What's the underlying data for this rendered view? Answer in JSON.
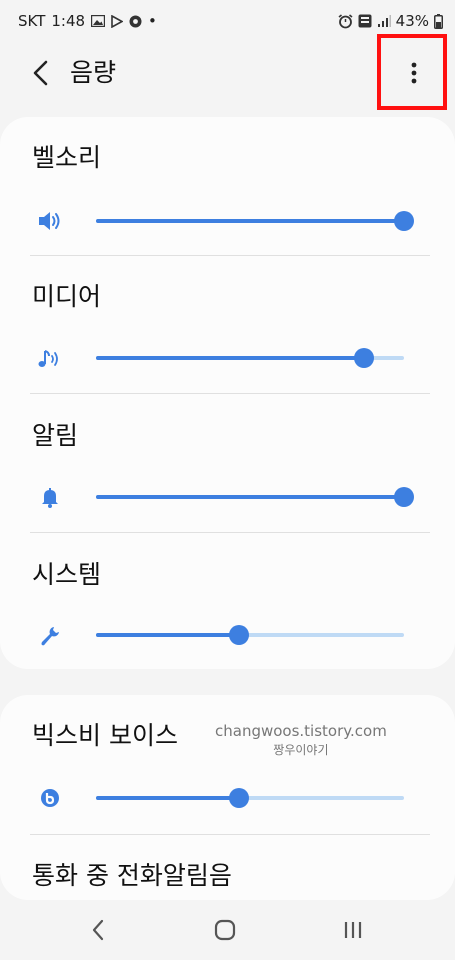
{
  "status_bar": {
    "carrier": "SKT",
    "time": "1:48",
    "dot": "•",
    "battery": "43%"
  },
  "header": {
    "title": "음량"
  },
  "sliders": [
    {
      "label": "벨소리",
      "icon": "speaker-icon",
      "level": 1.0
    },
    {
      "label": "미디어",
      "icon": "music-note-icon",
      "level": 0.87
    },
    {
      "label": "알림",
      "icon": "bell-icon",
      "level": 1.0
    },
    {
      "label": "시스템",
      "icon": "wrench-icon",
      "level": 0.465
    },
    {
      "label": "빅스비 보이스",
      "icon": "bixby-icon",
      "level": 0.465
    },
    {
      "label": "통화 중 전화알림음"
    }
  ],
  "watermark": {
    "line1": "changwoos.tistory.com",
    "line2": "짱우이야기"
  },
  "colors": {
    "accent": "#3d7fe0",
    "track": "#bfdaf5",
    "highlight": "#ff1010"
  }
}
